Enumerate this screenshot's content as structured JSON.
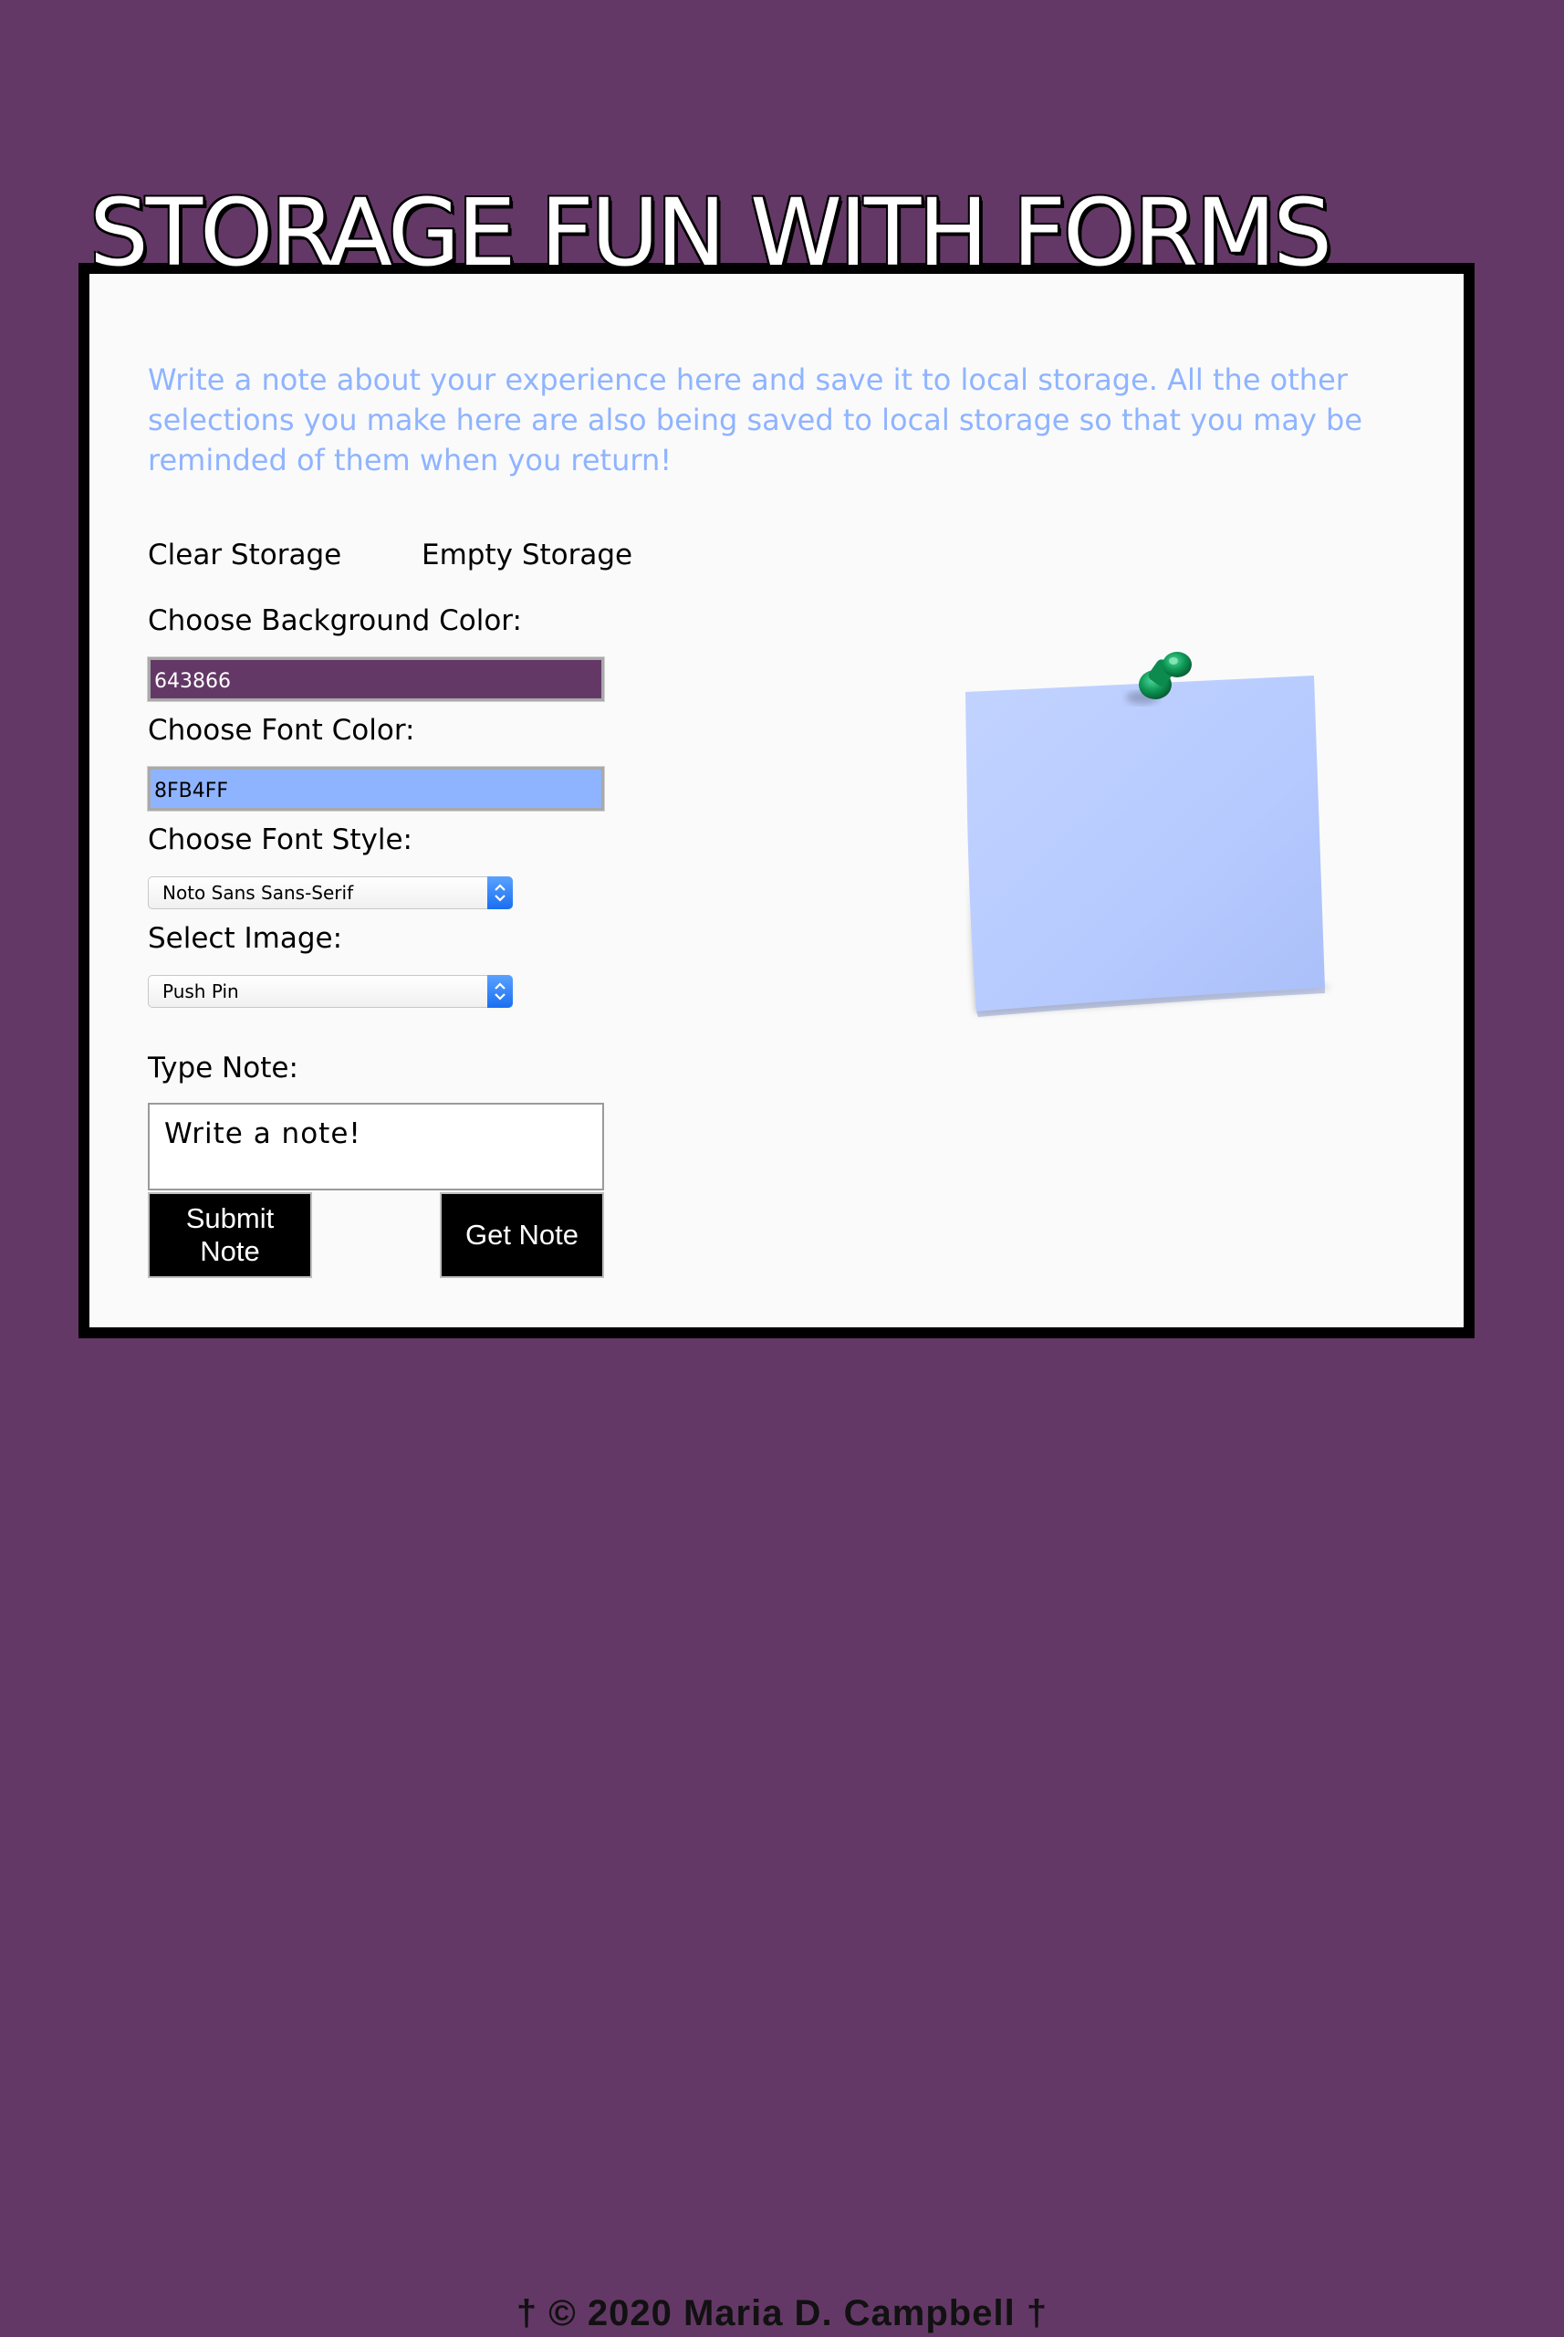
{
  "header": {
    "title": "STORAGE FUN WITH FORMS"
  },
  "intro": {
    "text": "Write a note about your experience here and save it to local storage. All the other selections you make here are also being saved to local storage so that you may be reminded of them when you return!"
  },
  "storage_links": {
    "clear": "Clear Storage",
    "empty": "Empty Storage"
  },
  "background_color": {
    "label": "Choose Background Color:",
    "value": "643866"
  },
  "font_color": {
    "label": "Choose Font Color:",
    "value": "8FB4FF"
  },
  "font_style": {
    "label": "Choose Font Style:",
    "selected": "Noto Sans Sans-Serif"
  },
  "image_select": {
    "label": "Select Image:",
    "selected": "Push Pin"
  },
  "note": {
    "label": "Type Note:",
    "value": "Write a note!"
  },
  "buttons": {
    "submit": "Submit Note",
    "get": "Get Note"
  },
  "footer": {
    "text": "† © 2020 Maria D. Campbell †"
  },
  "colors": {
    "page_background": "#643866",
    "accent_text": "#8fb4ff",
    "panel": "#fafafa",
    "sticky_note": "#bcd0ff",
    "pin": "#0a8a4a"
  },
  "icons": {
    "sticky_image": "sticky-note-with-push-pin"
  }
}
